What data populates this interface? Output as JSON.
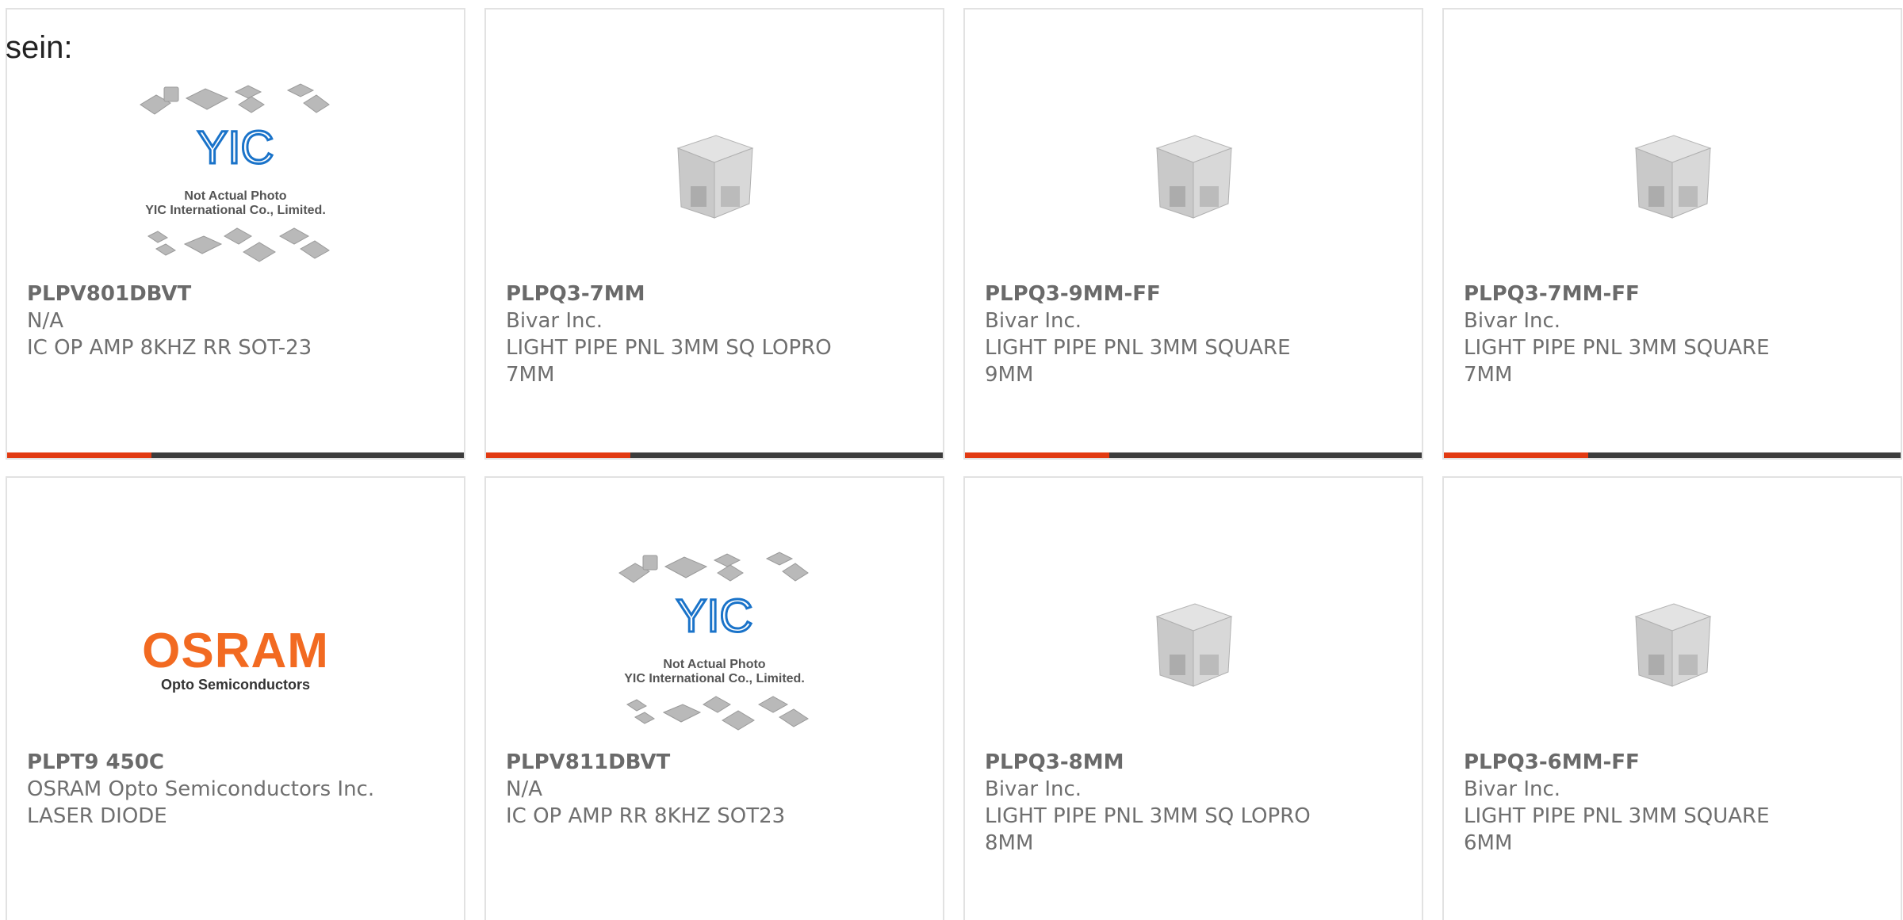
{
  "intro": {
    "text": "sein:"
  },
  "products": [
    {
      "part": "PLPV801DBVT",
      "manufacturer": "N/A",
      "description": "IC OP AMP 8KHZ RR SOT-23",
      "image": "placeholder",
      "placeholder_caption_1": "Not Actual Photo",
      "placeholder_caption_2": "YIC International Co., Limited.",
      "placeholder_logo": "YIC"
    },
    {
      "part": "PLPQ3-7MM",
      "manufacturer": "Bivar Inc.",
      "description": "LIGHT PIPE PNL 3MM SQ LOPRO 7MM",
      "image": "light-pipe"
    },
    {
      "part": "PLPQ3-9MM-FF",
      "manufacturer": "Bivar Inc.",
      "description": "LIGHT PIPE PNL 3MM SQUARE 9MM",
      "image": "light-pipe"
    },
    {
      "part": "PLPQ3-7MM-FF",
      "manufacturer": "Bivar Inc.",
      "description": "LIGHT PIPE PNL 3MM SQUARE 7MM",
      "image": "light-pipe"
    },
    {
      "part": "PLPT9 450C",
      "manufacturer": "OSRAM Opto Semiconductors Inc.",
      "description": "LASER DIODE",
      "image": "osram-logo",
      "logo_word": "OSRAM",
      "logo_sub": "Opto Semiconductors"
    },
    {
      "part": "PLPV811DBVT",
      "manufacturer": "N/A",
      "description": "IC OP AMP RR 8KHZ SOT23",
      "image": "placeholder",
      "placeholder_caption_1": "Not Actual Photo",
      "placeholder_caption_2": "YIC International Co., Limited.",
      "placeholder_logo": "YIC"
    },
    {
      "part": "PLPQ3-8MM",
      "manufacturer": "Bivar Inc.",
      "description": "LIGHT PIPE PNL 3MM SQ LOPRO 8MM",
      "image": "light-pipe"
    },
    {
      "part": "PLPQ3-6MM-FF",
      "manufacturer": "Bivar Inc.",
      "description": "LIGHT PIPE PNL 3MM SQUARE 6MM",
      "image": "light-pipe"
    }
  ],
  "colors": {
    "accent": "#e23a12",
    "bar": "#3c3c3c",
    "text": "#6f6f6f",
    "osram": "#f26a21",
    "yic_blue": "#1a73c9"
  }
}
